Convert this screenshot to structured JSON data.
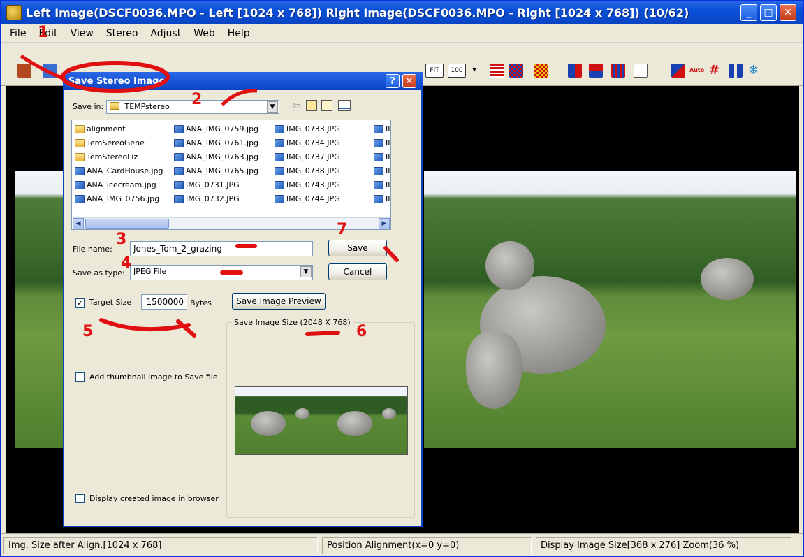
{
  "window": {
    "title": "Left Image(DSCF0036.MPO - Left [1024 x 768]) Right Image(DSCF0036.MPO - Right [1024 x 768])  (10/62)"
  },
  "menu": [
    "File",
    "Edit",
    "View",
    "Stereo",
    "Adjust",
    "Web",
    "Help"
  ],
  "toolbar": {
    "zoom_fit": "FIT",
    "zoom_100": "100",
    "auto": "Auto"
  },
  "dialog": {
    "title": "Save Stereo Image",
    "save_in_label": "Save in:",
    "save_in_value": "TEMPstereo",
    "files": {
      "col1": [
        {
          "name": "alignment",
          "type": "folder"
        },
        {
          "name": "TemSereoGene",
          "type": "folder"
        },
        {
          "name": "TemStereoLiz",
          "type": "folder"
        },
        {
          "name": "ANA_CardHouse.jpg",
          "type": "image"
        },
        {
          "name": "ANA_icecream.jpg",
          "type": "image"
        },
        {
          "name": "ANA_IMG_0756.jpg",
          "type": "image"
        }
      ],
      "col2": [
        {
          "name": "ANA_IMG_0759.jpg",
          "type": "image"
        },
        {
          "name": "ANA_IMG_0761.jpg",
          "type": "image"
        },
        {
          "name": "ANA_IMG_0763.jpg",
          "type": "image"
        },
        {
          "name": "ANA_IMG_0765.jpg",
          "type": "image"
        },
        {
          "name": "IMG_0731.JPG",
          "type": "image"
        },
        {
          "name": "IMG_0732.JPG",
          "type": "image"
        }
      ],
      "col3": [
        {
          "name": "IMG_0733.JPG",
          "type": "image"
        },
        {
          "name": "IMG_0734.JPG",
          "type": "image"
        },
        {
          "name": "IMG_0737.JPG",
          "type": "image"
        },
        {
          "name": "IMG_0738.JPG",
          "type": "image"
        },
        {
          "name": "IMG_0743.JPG",
          "type": "image"
        },
        {
          "name": "IMG_0744.JPG",
          "type": "image"
        }
      ],
      "col4_partial": "II"
    },
    "file_name_label": "File name:",
    "file_name_value": "Jones_Tom_2_grazing",
    "save_type_label": "Save as type:",
    "save_type_value": "JPEG File",
    "save_button": "Save",
    "cancel_button": "Cancel",
    "target_size_label": "Target Size",
    "target_size_value": "1500000",
    "bytes_label": "Bytes",
    "save_preview_button": "Save Image Preview",
    "save_image_size": "Save Image Size (2048 X 768)",
    "add_thumbnail_label": "Add thumbnail image to Save file",
    "display_browser_label": "Display created image in browser"
  },
  "annotations": [
    "1",
    "2",
    "3",
    "4",
    "5",
    "6",
    "7"
  ],
  "status": {
    "img_size": "Img. Size after Align.[1024 x 768]",
    "position": "Position Alignment(x=0 y=0)",
    "display": "Display Image Size[368 x 276]  Zoom(36 %)"
  },
  "colors": {
    "annotation": "#e01010",
    "title_blue": "#0a44c4"
  }
}
